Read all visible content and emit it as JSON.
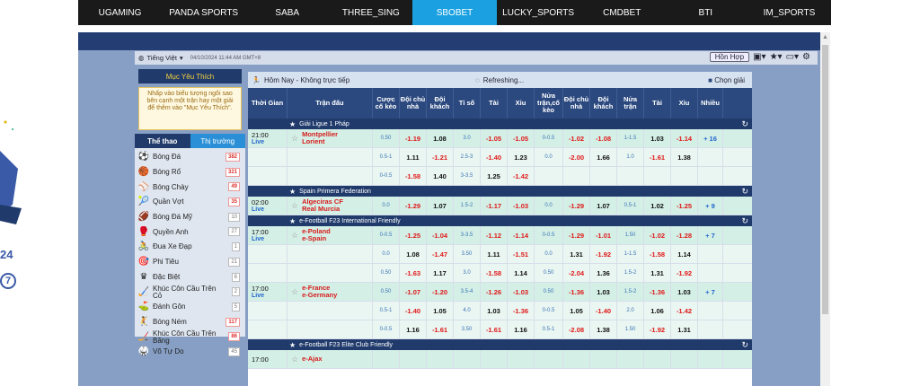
{
  "nav": {
    "tabs": [
      "UGAMING",
      "PANDA SPORTS",
      "SABA",
      "THREE_SING",
      "SBOBET",
      "LUCKY_SPORTS",
      "CMDBET",
      "BTI",
      "IM_SPORTS"
    ],
    "active": "SBOBET"
  },
  "gutter": {
    "text24": "24",
    "text7": "7"
  },
  "infobar": {
    "language": "Tiếng Việt",
    "datetime": "04/10/2024 11:44 AM GMT+8",
    "mybets": "Hồn Hợp"
  },
  "sidebar": {
    "fav_title": "Mục Yêu Thích",
    "fav_note": "Nhấp vào biểu tượng ngôi sao bên cạnh một trận hay một giải để thêm vào \"Mục Yêu Thích\".",
    "tab_sports": "Thể thao",
    "tab_markets": "Thị trường",
    "sports": [
      {
        "name": "Bóng Đá",
        "count": "382",
        "icon": "soccer-icon",
        "hot": true
      },
      {
        "name": "Bóng Rổ",
        "count": "321",
        "icon": "basketball-icon",
        "hot": true
      },
      {
        "name": "Bóng Chày",
        "count": "49",
        "icon": "baseball-icon",
        "hot": true
      },
      {
        "name": "Quần Vợt",
        "count": "35",
        "icon": "tennis-icon",
        "hot": true
      },
      {
        "name": "Bóng Đá Mỹ",
        "count": "10",
        "icon": "american-football-icon",
        "hot": false
      },
      {
        "name": "Quyền Anh",
        "count": "27",
        "icon": "boxing-icon",
        "hot": false
      },
      {
        "name": "Đua Xe Đạp",
        "count": "1",
        "icon": "cycling-icon",
        "hot": false
      },
      {
        "name": "Phi Tiêu",
        "count": "21",
        "icon": "darts-icon",
        "hot": false
      },
      {
        "name": "Đặc Biệt",
        "count": "6",
        "icon": "special-icon",
        "hot": false
      },
      {
        "name": "Khúc Côn Cầu Trên Cỏ",
        "count": "2",
        "icon": "field-hockey-icon",
        "hot": false
      },
      {
        "name": "Đánh Gôn",
        "count": "5",
        "icon": "golf-icon",
        "hot": false
      },
      {
        "name": "Bóng Ném",
        "count": "117",
        "icon": "handball-icon",
        "hot": true
      },
      {
        "name": "Khúc Côn Cầu Trên Băng",
        "count": "86",
        "icon": "ice-hockey-icon",
        "hot": true
      },
      {
        "name": "Võ Tự Do",
        "count": "45",
        "icon": "mma-icon",
        "hot": false
      }
    ]
  },
  "main": {
    "title": "Hôm Nay - Không trực tiếp",
    "refreshing": "Refreshing...",
    "choose_league": "Chọn giải",
    "columns": [
      "Thời Gian",
      "Trận đấu",
      "Cược cố kèo",
      "Đội chủ nhà",
      "Đội khách",
      "Tỉ số",
      "Tài",
      "Xỉu",
      "Nửa trận,cố kèo",
      "Đội chủ nhà",
      "Đội khách",
      "Nửa trận",
      "Tài",
      "Xỉu",
      "Nhiều"
    ],
    "leagues": [
      {
        "name": "Giải Ligue 1 Pháp",
        "rows": [
          {
            "time": "21:00",
            "live": "Live",
            "home": "Montpellier",
            "away": "Lorient",
            "c": [
              "0.50",
              "-1.19",
              "1.08",
              "3.0",
              "-1.05",
              "-1.05",
              "0-0.5",
              "-1.02",
              "-1.08",
              "1-1.5",
              "1.03",
              "-1.14"
            ],
            "more": "+ 16"
          },
          {
            "c": [
              "0.5-1",
              "1.11",
              "-1.21",
              "2.5-3",
              "-1.40",
              "1.23",
              "0.0",
              "-2.00",
              "1.66",
              "1.0",
              "-1.61",
              "1.38"
            ]
          },
          {
            "c": [
              "0-0.5",
              "-1.58",
              "1.40",
              "3-3.5",
              "1.25",
              "-1.42",
              "",
              "",
              "",
              "",
              "",
              ""
            ]
          }
        ]
      },
      {
        "name": "Spain Primera Federation",
        "rows": [
          {
            "time": "02:00",
            "live": "Live",
            "home": "Algeciras CF",
            "away": "Real Murcia",
            "c": [
              "0.0",
              "-1.29",
              "1.07",
              "1.5-2",
              "-1.17",
              "-1.03",
              "0.0",
              "-1.29",
              "1.07",
              "0.5-1",
              "1.02",
              "-1.25"
            ],
            "more": "+ 9"
          }
        ]
      },
      {
        "name": "e-Football F23 International Friendly",
        "rows": [
          {
            "time": "17:00",
            "live": "Live",
            "home": "e-Poland",
            "away": "e-Spain",
            "c": [
              "0-0.5",
              "-1.25",
              "-1.04",
              "3-3.5",
              "-1.12",
              "-1.14",
              "0-0.5",
              "-1.29",
              "-1.01",
              "1.50",
              "-1.02",
              "-1.28"
            ],
            "more": "+ 7"
          },
          {
            "c": [
              "0.0",
              "1.08",
              "-1.47",
              "3.50",
              "1.11",
              "-1.51",
              "0.0",
              "1.31",
              "-1.92",
              "1-1.5",
              "-1.58",
              "1.14"
            ]
          },
          {
            "c": [
              "0.50",
              "-1.63",
              "1.17",
              "3.0",
              "-1.58",
              "1.14",
              "0.50",
              "-2.04",
              "1.36",
              "1.5-2",
              "1.31",
              "-1.92"
            ]
          },
          {
            "time": "17:00",
            "live": "Live",
            "home": "e-France",
            "away": "e-Germany",
            "c": [
              "0.50",
              "-1.07",
              "-1.20",
              "3.5-4",
              "-1.26",
              "-1.03",
              "0.50",
              "-1.36",
              "1.03",
              "1.5-2",
              "-1.36",
              "1.03"
            ],
            "more": "+ 7"
          },
          {
            "c": [
              "0.5-1",
              "-1.40",
              "1.05",
              "4.0",
              "1.03",
              "-1.36",
              "0-0.5",
              "1.05",
              "-1.40",
              "2.0",
              "1.06",
              "-1.42"
            ]
          },
          {
            "c": [
              "0-0.5",
              "1.16",
              "-1.61",
              "3.50",
              "-1.61",
              "1.16",
              "0.5-1",
              "-2.08",
              "1.38",
              "1.50",
              "-1.92",
              "1.31"
            ]
          }
        ]
      },
      {
        "name": "e-Football F23 Elite Club Friendly",
        "rows": [
          {
            "time": "17:00",
            "live": "",
            "home": "e-Ajax",
            "away": "",
            "c": [
              "",
              "",
              "",
              "",
              "",
              "",
              "",
              "",
              "",
              "",
              "",
              ""
            ]
          }
        ]
      }
    ]
  }
}
